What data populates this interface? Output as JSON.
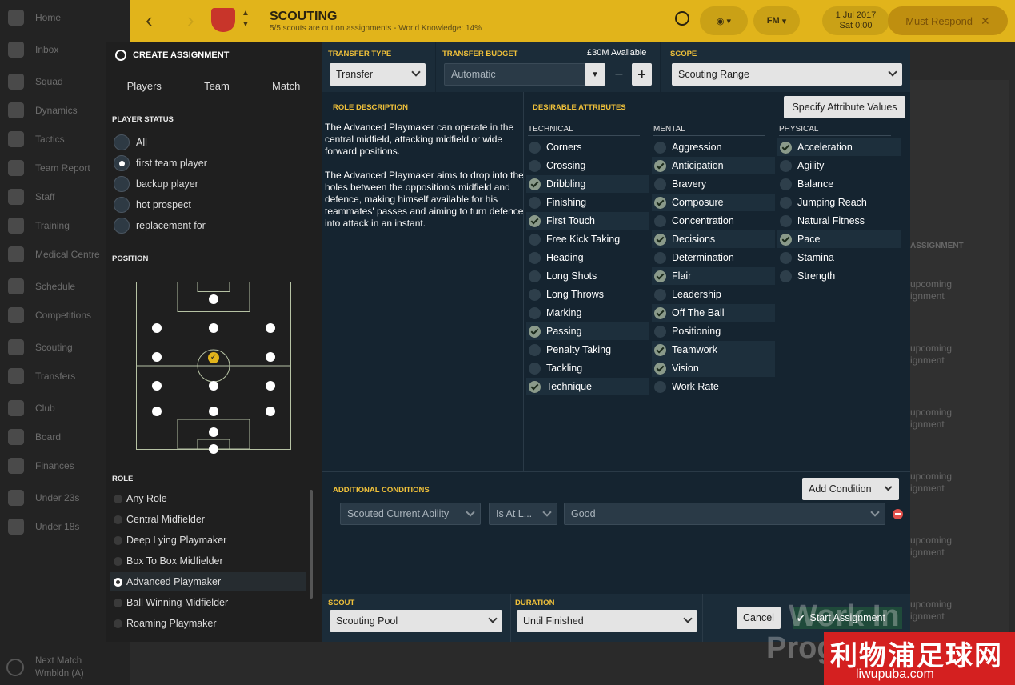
{
  "nav": {
    "items": [
      {
        "label": "Home",
        "icon": "home-icon"
      },
      {
        "label": "Inbox",
        "icon": "inbox-icon"
      },
      {
        "label": "Squad",
        "icon": "squad-icon"
      },
      {
        "label": "Dynamics",
        "icon": "dynamics-icon"
      },
      {
        "label": "Tactics",
        "icon": "tactics-icon"
      },
      {
        "label": "Team Report",
        "icon": "report-icon"
      },
      {
        "label": "Staff",
        "icon": "staff-icon"
      },
      {
        "label": "Training",
        "icon": "training-icon"
      },
      {
        "label": "Medical Centre",
        "icon": "medical-icon"
      },
      {
        "label": "Schedule",
        "icon": "schedule-icon"
      },
      {
        "label": "Competitions",
        "icon": "trophy-icon"
      },
      {
        "label": "Scouting",
        "icon": "search-icon"
      },
      {
        "label": "Transfers",
        "icon": "transfers-icon"
      },
      {
        "label": "Club",
        "icon": "club-icon"
      },
      {
        "label": "Board",
        "icon": "board-icon"
      },
      {
        "label": "Finances",
        "icon": "finances-icon"
      },
      {
        "label": "Under 23s",
        "icon": "u23-icon"
      },
      {
        "label": "Under 18s",
        "icon": "u18-icon"
      }
    ],
    "next_match_label": "Next Match",
    "next_match_opponent": "Wmbldn (A)"
  },
  "topbar": {
    "title": "SCOUTING",
    "subtitle": "5/5 scouts are out on assignments - World Knowledge: 14%",
    "fm_label": "FM",
    "date": "1 Jul 2017",
    "time": "Sat 0:00",
    "must_respond": "Must Respond"
  },
  "left_panel": {
    "title": "CREATE ASSIGNMENT",
    "tabs": [
      "Players",
      "Team",
      "Match"
    ],
    "player_status_title": "PLAYER STATUS",
    "player_status": [
      {
        "label": "All",
        "selected": false
      },
      {
        "label": "first team player",
        "selected": true
      },
      {
        "label": "backup player",
        "selected": false
      },
      {
        "label": "hot prospect",
        "selected": false
      },
      {
        "label": "replacement for",
        "selected": false
      }
    ],
    "position_title": "POSITION",
    "role_title": "ROLE",
    "roles": [
      {
        "label": "Any Role",
        "selected": false
      },
      {
        "label": "Central Midfielder",
        "selected": false
      },
      {
        "label": "Deep Lying Playmaker",
        "selected": false
      },
      {
        "label": "Box To Box Midfielder",
        "selected": false
      },
      {
        "label": "Advanced Playmaker",
        "selected": true
      },
      {
        "label": "Ball Winning Midfielder",
        "selected": false
      },
      {
        "label": "Roaming Playmaker",
        "selected": false
      }
    ]
  },
  "right_panel": {
    "transfer_type_label": "TRANSFER TYPE",
    "transfer_type_value": "Transfer",
    "transfer_budget_label": "TRANSFER BUDGET",
    "transfer_budget_available": "£30M Available",
    "transfer_budget_value": "Automatic",
    "scope_label": "SCOPE",
    "scope_value": "Scouting Range",
    "role_description_label": "ROLE DESCRIPTION",
    "role_description_p1": "The Advanced Playmaker can operate in the central midfield, attacking midfield or wide forward positions.",
    "role_description_p2": "The Advanced Playmaker aims to drop into the holes between the opposition's midfield and defence, making himself available for his teammates' passes and aiming to turn defence into attack in an instant.",
    "desirable_label": "DESIRABLE ATTRIBUTES",
    "specify_button": "Specify Attribute Values",
    "technical_label": "TECHNICAL",
    "mental_label": "MENTAL",
    "physical_label": "PHYSICAL",
    "technical": [
      {
        "label": "Corners",
        "on": false
      },
      {
        "label": "Crossing",
        "on": false
      },
      {
        "label": "Dribbling",
        "on": true
      },
      {
        "label": "Finishing",
        "on": false
      },
      {
        "label": "First Touch",
        "on": true
      },
      {
        "label": "Free Kick Taking",
        "on": false
      },
      {
        "label": "Heading",
        "on": false
      },
      {
        "label": "Long Shots",
        "on": false
      },
      {
        "label": "Long Throws",
        "on": false
      },
      {
        "label": "Marking",
        "on": false
      },
      {
        "label": "Passing",
        "on": true
      },
      {
        "label": "Penalty Taking",
        "on": false
      },
      {
        "label": "Tackling",
        "on": false
      },
      {
        "label": "Technique",
        "on": true
      }
    ],
    "mental": [
      {
        "label": "Aggression",
        "on": false
      },
      {
        "label": "Anticipation",
        "on": true
      },
      {
        "label": "Bravery",
        "on": false
      },
      {
        "label": "Composure",
        "on": true
      },
      {
        "label": "Concentration",
        "on": false
      },
      {
        "label": "Decisions",
        "on": true
      },
      {
        "label": "Determination",
        "on": false
      },
      {
        "label": "Flair",
        "on": true
      },
      {
        "label": "Leadership",
        "on": false
      },
      {
        "label": "Off The Ball",
        "on": true
      },
      {
        "label": "Positioning",
        "on": false
      },
      {
        "label": "Teamwork",
        "on": true
      },
      {
        "label": "Vision",
        "on": true
      },
      {
        "label": "Work Rate",
        "on": false
      }
    ],
    "physical": [
      {
        "label": "Acceleration",
        "on": true
      },
      {
        "label": "Agility",
        "on": false
      },
      {
        "label": "Balance",
        "on": false
      },
      {
        "label": "Jumping Reach",
        "on": false
      },
      {
        "label": "Natural Fitness",
        "on": false
      },
      {
        "label": "Pace",
        "on": true
      },
      {
        "label": "Stamina",
        "on": false
      },
      {
        "label": "Strength",
        "on": false
      }
    ],
    "additional_conditions_label": "ADDITIONAL CONDITIONS",
    "add_condition_button": "Add Condition",
    "condition_field": "Scouted Current Ability",
    "condition_operator": "Is At L...",
    "condition_value": "Good",
    "scout_label": "SCOUT",
    "scout_value": "Scouting Pool",
    "duration_label": "DURATION",
    "duration_value": "Until Finished",
    "cancel_button": "Cancel",
    "start_button": "Start Assignment"
  },
  "background": {
    "assignment_header": "ASSIGNMENT",
    "upcoming_line1": "upcoming",
    "upcoming_line2": "ignment"
  },
  "overlay": {
    "watermark_line1": "Work In",
    "watermark_line2": "Prog",
    "site_cn": "利物浦足球网",
    "site_url": "liwupuba.com"
  },
  "colors": {
    "accent_yellow": "#e1b41b",
    "label_gold": "#f0c13a",
    "panel_blue": "#152430",
    "danger_red": "#e0504a"
  }
}
